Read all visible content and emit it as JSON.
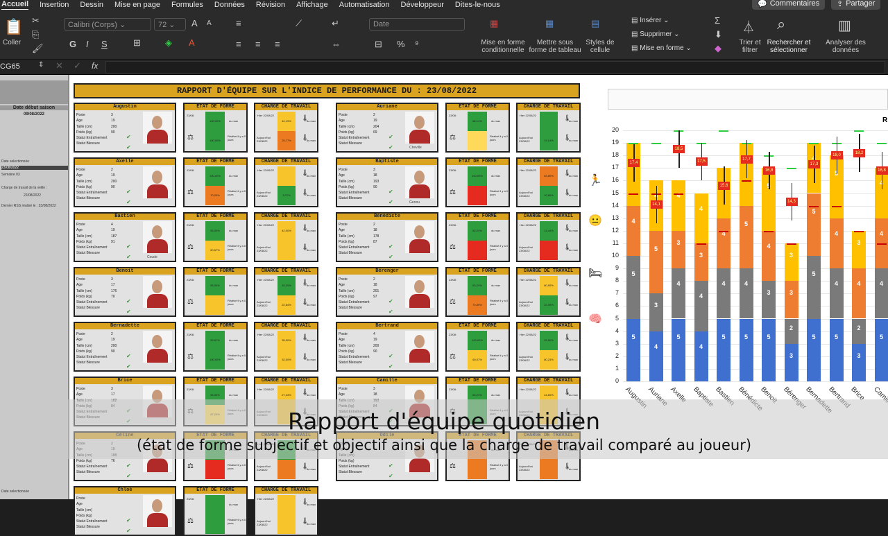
{
  "ribbon": {
    "tabs": [
      "Accueil",
      "Insertion",
      "Dessin",
      "Mise en page",
      "Formules",
      "Données",
      "Révision",
      "Affichage",
      "Automatisation",
      "Développeur",
      "Dites-le-nous"
    ],
    "comments_label": "Commentaires",
    "share_label": "Partager",
    "paste_label": "Coller",
    "font_name": "Calibri (Corps)",
    "font_size": "72",
    "number_format": "Date",
    "conditional_label": "Mise en forme conditionnelle",
    "table_label": "Mettre sous forme de tableau",
    "styles_label": "Styles de cellule",
    "insert_label": "Insérer",
    "delete_label": "Supprimer",
    "format_label": "Mise en forme",
    "sort_label": "Trier et filtrer",
    "find_label": "Rechercher et sélectionner",
    "analyze_label": "Analyser des données"
  },
  "formula_bar": {
    "cell_ref": "CG65",
    "fx": "fx"
  },
  "left_pane": {
    "start_label": "Date début saison",
    "start_date": "09/08/2022",
    "date_selected_label": "Date selectionnée",
    "date_selected": "23/08/2022",
    "week_label": "Semaine 03",
    "load_note": "Charge de travail de la veille :",
    "load_date": "22/08/2022",
    "rss_note": "Dernier RSS réalisé le : 23/08/2022",
    "date_selected_label2": "Date selectionnée"
  },
  "report": {
    "title": "RAPPORT D'ÉQUIPE SUR L'INDICE DE PERFORMANCE DU : 23/08/2022"
  },
  "card_labels": {
    "rows": [
      "Poste",
      "Age",
      "Taille (cm)",
      "Poids (kg)",
      "Statut Entraînement",
      "Statut Blessure"
    ],
    "form_header": "ÉTAT DE FORME",
    "load_header": "CHARGE DE TRAVAIL",
    "date": "23/08:",
    "du_max": "du max",
    "realise": "Réalisé il y a 0 jours",
    "hier": "Hier 22/08/22",
    "today": "Aujourd'hui 23/08/22"
  },
  "players": [
    {
      "name": "Augustin",
      "vals": [
        "3",
        "19",
        "200",
        "90"
      ],
      "f1": "100,00%",
      "f2": "100,00%",
      "c1": "40,19%",
      "c2": "25,77%",
      "fc": [
        "green",
        "green"
      ],
      "cc": [
        "yellow",
        "orange"
      ]
    },
    {
      "name": "Auriane",
      "vals": [
        "2",
        "19",
        "204",
        "69"
      ],
      "f1": "86,14%",
      "f2": "",
      "c1": "",
      "c2": "19,14%",
      "fc": [
        "green",
        "ltyellow"
      ],
      "cc": [
        "green",
        "green"
      ],
      "note": "Cheville"
    },
    {
      "name": "Axelle",
      "vals": [
        "2",
        "19",
        "200",
        "90"
      ],
      "f1": "100,00%",
      "f2": "70,29%",
      "c1": "",
      "c2": "3,27%",
      "fc": [
        "green",
        "orange"
      ],
      "cc": [
        "yellow",
        "green"
      ]
    },
    {
      "name": "Baptiste",
      "vals": [
        "3",
        "18",
        "193",
        "90"
      ],
      "f1": "100,00%",
      "f2": "",
      "c1": "63,80%",
      "c2": "10,80%",
      "fc": [
        "green",
        "red"
      ],
      "cc": [
        "orange",
        "green"
      ],
      "note": "Genou"
    },
    {
      "name": "Bastien",
      "vals": [
        "4",
        "19",
        "187",
        "91"
      ],
      "f1": "95,00%",
      "f2": "60,67%",
      "c1": "42,00%",
      "c2": "",
      "fc": [
        "green",
        "yellow"
      ],
      "cc": [
        "yellow",
        "yellow"
      ],
      "note": "Coude"
    },
    {
      "name": "Bénédicte",
      "vals": [
        "2",
        "18",
        "178",
        "87"
      ],
      "f1": "82,23%",
      "f2": "",
      "c1": "13,44%",
      "c2": "",
      "fc": [
        "green",
        "red"
      ],
      "cc": [
        "green",
        "red"
      ]
    },
    {
      "name": "Benoit",
      "vals": [
        "3",
        "17",
        "176",
        "70"
      ],
      "f1": "95,00%",
      "f2": "",
      "c1": "33,20%",
      "c2": "22,84%",
      "fc": [
        "green",
        "yellow"
      ],
      "cc": [
        "green",
        "yellow"
      ]
    },
    {
      "name": "Bérenger",
      "vals": [
        "2",
        "18",
        "201",
        "97"
      ],
      "f1": "82,23%",
      "f2": "70,89%",
      "c1": "60,50%",
      "c2": "22,39%",
      "fc": [
        "green",
        "orange"
      ],
      "cc": [
        "yellow",
        "green"
      ]
    },
    {
      "name": "Bernadette",
      "vals": [
        "2",
        "19",
        "200",
        "90"
      ],
      "f1": "99,67%",
      "f2": "100,00%",
      "c1": "35,00%",
      "c2": "32,00%",
      "fc": [
        "green",
        "green"
      ],
      "cc": [
        "yellow",
        "yellow"
      ]
    },
    {
      "name": "Bertrand",
      "vals": [
        "4",
        "19",
        "200",
        "90"
      ],
      "f1": "100,00%",
      "f2": "60,07%",
      "c1": "25,50%",
      "c2": "80,23%",
      "fc": [
        "green",
        "yellow"
      ],
      "cc": [
        "green",
        "yellow"
      ]
    },
    {
      "name": "Brice",
      "vals": [
        "3",
        "17",
        "182",
        "84"
      ],
      "f1": "95,00%",
      "f2": "87,20%",
      "c1": "27,23%",
      "c2": "",
      "fc": [
        "green",
        "ltyellow"
      ],
      "cc": [
        "yellow",
        "yellow"
      ]
    },
    {
      "name": "Camille",
      "vals": [
        "3",
        "18",
        "193",
        "84"
      ],
      "f1": "82,23%",
      "f2": "",
      "c1": "44,60%",
      "c2": "",
      "fc": [
        "green",
        "green"
      ],
      "cc": [
        "yellow",
        "yellow"
      ]
    },
    {
      "name": "Céline",
      "vals": [
        "2",
        "19",
        "188",
        "76"
      ],
      "f1": "",
      "f2": "",
      "c1": "",
      "c2": "",
      "fc": [
        "green",
        "red"
      ],
      "cc": [
        "green",
        "orange"
      ]
    },
    {
      "name": "Odile",
      "vals": [
        "",
        "",
        "",
        ""
      ],
      "f1": "",
      "f2": "",
      "c1": "",
      "c2": "",
      "fc": [
        "orange",
        "orange"
      ],
      "cc": [
        "orange",
        "orange"
      ]
    },
    {
      "name": "Chloé",
      "vals": [
        "",
        "",
        "",
        ""
      ],
      "f1": "",
      "f2": "",
      "c1": "",
      "c2": "",
      "fc": [
        "green",
        "green"
      ],
      "cc": [
        "yellow",
        "yellow"
      ]
    }
  ],
  "chart_data": {
    "type": "bar",
    "stacked": true,
    "categories": [
      "Augustin",
      "Auriane",
      "Axelle",
      "Baptiste",
      "Bastien",
      "Bénédicte",
      "Benoit",
      "Bérenger",
      "Bernadette",
      "Bertrand",
      "Brice",
      "Camille"
    ],
    "series": [
      {
        "color": "#3f6fcf",
        "values": [
          5,
          4,
          5,
          4,
          5,
          5,
          5,
          3,
          5,
          5,
          3,
          5
        ]
      },
      {
        "color": "#7a7a7a",
        "values": [
          5,
          3,
          4,
          4,
          4,
          4,
          3,
          2,
          5,
          4,
          2,
          4
        ]
      },
      {
        "color": "#ee7d31",
        "values": [
          4,
          5,
          3,
          3,
          4,
          5,
          4,
          3,
          5,
          4,
          4,
          4
        ]
      },
      {
        "color": "#ffc000",
        "values": [
          5,
          4,
          4,
          4,
          4,
          5,
          5,
          3,
          4,
          5,
          3,
          4
        ]
      }
    ],
    "ylim": [
      0,
      20
    ],
    "yticks": [
      0,
      1,
      2,
      3,
      4,
      5,
      6,
      7,
      8,
      9,
      10,
      11,
      12,
      13,
      14,
      15,
      16,
      17,
      18,
      19,
      20
    ],
    "marker_values": [
      17.4,
      14.1,
      18.5,
      17.5,
      15.6,
      17.7,
      16.8,
      14.3,
      17.3,
      18.0,
      18.2,
      16.8
    ],
    "marker_labels": [
      "17,4",
      "14,1",
      "18,5",
      "17,5",
      "15,6",
      "17,7",
      "16,8",
      "14,3",
      "17,3",
      "18,0",
      "18,2",
      "16,8"
    ],
    "green_marks": [
      19,
      19,
      20,
      19,
      20,
      19,
      18,
      17,
      19,
      19,
      20,
      19
    ],
    "red_marks": [
      15,
      15,
      15,
      11,
      12,
      16,
      12,
      11,
      14,
      14,
      12,
      11
    ],
    "title_letter": "R"
  },
  "caption": {
    "line1": "Rapport d'équipe quotidien",
    "line2": "(état de forme subjectif et objectif ainsi que la charge de travail comparé au joueur)"
  }
}
